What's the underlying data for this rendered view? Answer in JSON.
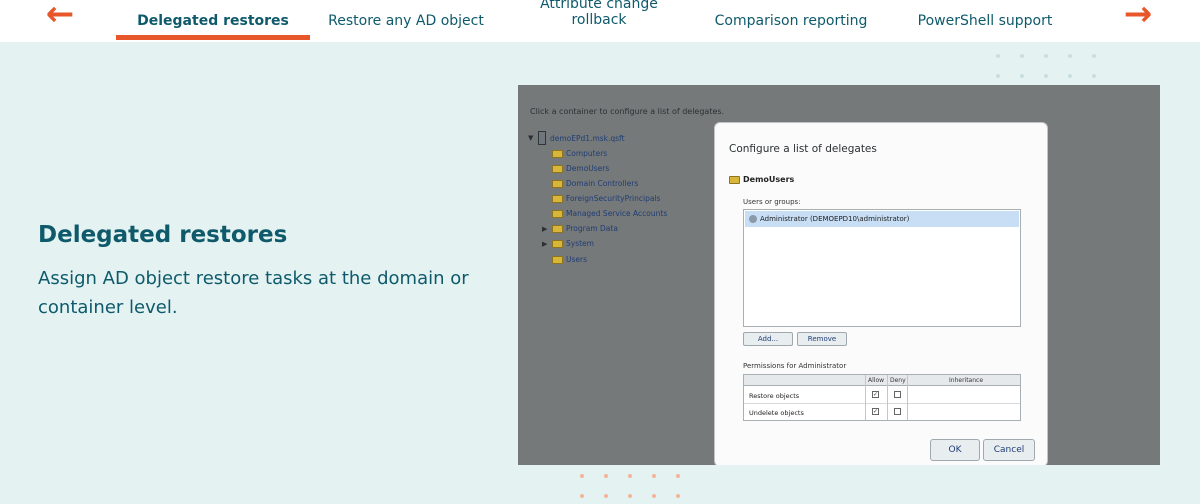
{
  "nav": {
    "prev_icon": "arrow-left-icon",
    "next_icon": "arrow-right-icon",
    "tabs": [
      {
        "label": "Delegated restores",
        "active": true
      },
      {
        "label": "Restore any AD object",
        "active": false
      },
      {
        "label_line1": "Attribute change",
        "label_line2": "rollback",
        "active": false
      },
      {
        "label": "Comparison reporting",
        "active": false
      },
      {
        "label": "PowerShell support",
        "active": false
      }
    ],
    "accent_color": "#e8572a"
  },
  "feature": {
    "title": "Delegated restores",
    "description": "Assign AD object restore tasks at the domain or container level."
  },
  "screenshot": {
    "hint": "Click a container to configure a list of delegates.",
    "tree": {
      "root": "demoEPd1.msk.qsft",
      "items": [
        "Computers",
        "DemoUsers",
        "Domain Controllers",
        "ForeignSecurityPrincipals",
        "Managed Service Accounts",
        "Program Data",
        "System",
        "Users"
      ]
    },
    "dialog": {
      "title": "Configure a list of delegates",
      "container": "DemoUsers",
      "users_label": "Users or groups:",
      "users": [
        "Administrator (DEMOEPD10\\administrator)"
      ],
      "add_button": "Add...",
      "remove_button": "Remove",
      "permissions_label": "Permissions for Administrator",
      "columns": [
        "Allow",
        "Deny",
        "Inheritance"
      ],
      "permissions": [
        {
          "name": "Restore objects",
          "allow": true,
          "deny": false
        },
        {
          "name": "Undelete objects",
          "allow": true,
          "deny": false
        }
      ],
      "ok_button": "OK",
      "cancel_button": "Cancel"
    }
  },
  "colors": {
    "text": "#0e5a6b",
    "background": "#e4f2f2",
    "dots_teal": "#c7dfe0",
    "dots_orange": "#f3b59a"
  }
}
